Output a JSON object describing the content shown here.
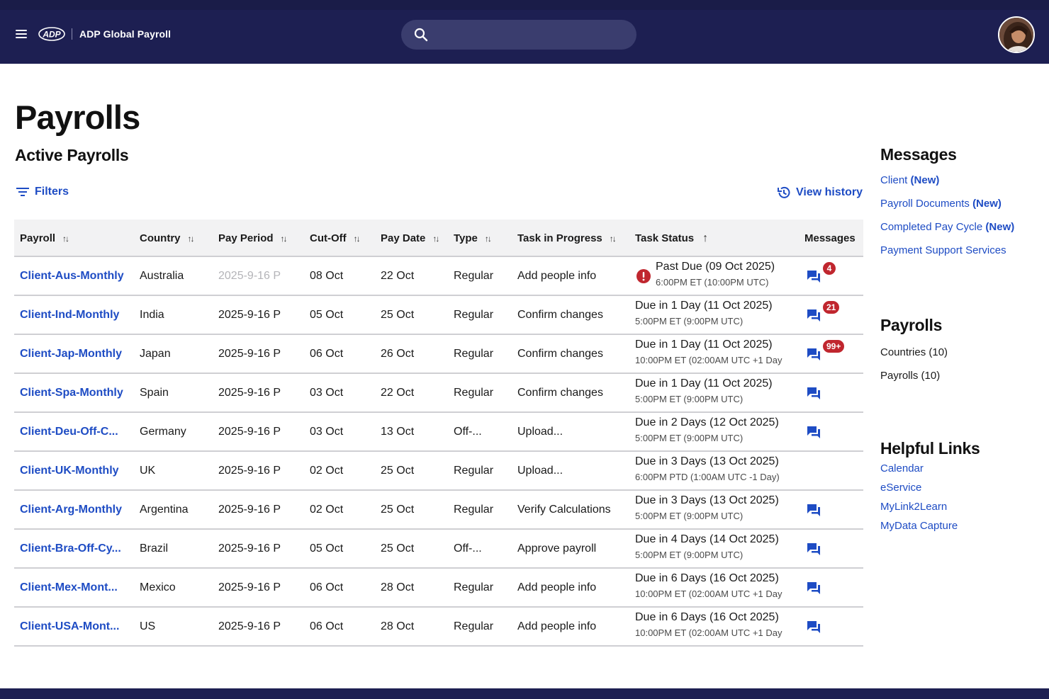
{
  "header": {
    "app_title": "ADP Global Payroll",
    "logo_text": "ADP",
    "search": {
      "value": "",
      "placeholder": ""
    }
  },
  "page": {
    "title": "Payrolls",
    "section_title": "Active Payrolls",
    "filters_label": "Filters",
    "view_history_label": "View history"
  },
  "table": {
    "columns": [
      "Payroll",
      "Country",
      "Pay Period",
      "Cut-Off",
      "Pay Date",
      "Type",
      "Task in Progress",
      "Task Status",
      "Messages"
    ],
    "rows": [
      {
        "payroll": "Client-Aus-Monthly",
        "country": "Australia",
        "pay_period": "2025-9-16 P",
        "cutoff": "08 Oct",
        "pay_date": "22 Oct",
        "type": "Regular",
        "task": "Add people info",
        "status": "Past Due (09 Oct 2025)",
        "status_time": "6:00PM ET (10:00PM UTC)",
        "alert": true,
        "messages": "4",
        "has_msg": true
      },
      {
        "payroll": "Client-Ind-Monthly",
        "country": "India",
        "pay_period": "2025-9-16 P",
        "cutoff": "05 Oct",
        "pay_date": "25 Oct",
        "type": "Regular",
        "task": "Confirm changes",
        "status": "Due in 1 Day (11 Oct 2025)",
        "status_time": "5:00PM ET (9:00PM UTC)",
        "alert": false,
        "messages": "21",
        "has_msg": true
      },
      {
        "payroll": "Client-Jap-Monthly",
        "country": "Japan",
        "pay_period": "2025-9-16 P",
        "cutoff": "06 Oct",
        "pay_date": "26 Oct",
        "type": "Regular",
        "task": "Confirm changes",
        "status": "Due in 1 Day (11 Oct 2025)",
        "status_time": "10:00PM ET (02:00AM UTC +1 Day",
        "alert": false,
        "messages": "99+",
        "has_msg": true
      },
      {
        "payroll": "Client-Spa-Monthly",
        "country": "Spain",
        "pay_period": "2025-9-16 P",
        "cutoff": "03 Oct",
        "pay_date": "22 Oct",
        "type": "Regular",
        "task": "Confirm changes",
        "status": "Due in 1 Day (11 Oct 2025)",
        "status_time": "5:00PM ET (9:00PM UTC)",
        "alert": false,
        "messages": "",
        "has_msg": true
      },
      {
        "payroll": "Client-Deu-Off-C...",
        "country": "Germany",
        "pay_period": "2025-9-16 P",
        "cutoff": "03 Oct",
        "pay_date": "13 Oct",
        "type": "Off-...",
        "task": "Upload...",
        "status": "Due in 2 Days (12 Oct 2025)",
        "status_time": "5:00PM ET (9:00PM UTC)",
        "alert": false,
        "messages": "",
        "has_msg": true
      },
      {
        "payroll": "Client-UK-Monthly",
        "country": "UK",
        "pay_period": "2025-9-16 P",
        "cutoff": "02 Oct",
        "pay_date": "25 Oct",
        "type": "Regular",
        "task": "Upload...",
        "status": "Due in 3 Days (13 Oct 2025)",
        "status_time": "6:00PM PTD (1:00AM UTC -1 Day)",
        "alert": false,
        "messages": "",
        "has_msg": false
      },
      {
        "payroll": "Client-Arg-Monthly",
        "country": "Argentina",
        "pay_period": "2025-9-16 P",
        "cutoff": "02 Oct",
        "pay_date": "25 Oct",
        "type": "Regular",
        "task": "Verify Calculations",
        "status": "Due in 3 Days (13 Oct 2025)",
        "status_time": "5:00PM ET (9:00PM UTC)",
        "alert": false,
        "messages": "",
        "has_msg": true
      },
      {
        "payroll": "Client-Bra-Off-Cy...",
        "country": "Brazil",
        "pay_period": "2025-9-16 P",
        "cutoff": "05 Oct",
        "pay_date": "25 Oct",
        "type": "Off-...",
        "task": "Approve payroll",
        "status": "Due in 4 Days (14 Oct 2025)",
        "status_time": "5:00PM ET (9:00PM UTC)",
        "alert": false,
        "messages": "",
        "has_msg": true
      },
      {
        "payroll": "Client-Mex-Mont...",
        "country": "Mexico",
        "pay_period": "2025-9-16 P",
        "cutoff": "06 Oct",
        "pay_date": "28 Oct",
        "type": "Regular",
        "task": "Add people info",
        "status": "Due in 6 Days (16 Oct 2025)",
        "status_time": "10:00PM ET (02:00AM UTC +1 Day",
        "alert": false,
        "messages": "",
        "has_msg": true
      },
      {
        "payroll": "Client-USA-Mont...",
        "country": "US",
        "pay_period": "2025-9-16 P",
        "cutoff": "06 Oct",
        "pay_date": "28 Oct",
        "type": "Regular",
        "task": "Add people info",
        "status": "Due in 6 Days (16 Oct 2025)",
        "status_time": "10:00PM ET (02:00AM UTC +1 Day",
        "alert": false,
        "messages": "",
        "has_msg": true
      }
    ]
  },
  "sidebar": {
    "messages": {
      "title": "Messages",
      "items": [
        {
          "label": "Client",
          "tag": "(New)"
        },
        {
          "label": "Payroll Documents",
          "tag": "(New)"
        },
        {
          "label": "Completed Pay Cycle",
          "tag": "(New)"
        },
        {
          "label": "Payment Support Services",
          "tag": ""
        }
      ]
    },
    "payrolls": {
      "title": "Payrolls",
      "items": [
        "Countries (10)",
        "Payrolls (10)"
      ]
    },
    "helpful_links": {
      "title": "Helpful Links",
      "items": [
        "Calendar",
        "eService",
        "MyLink2Learn",
        "MyData Capture"
      ]
    }
  },
  "colors": {
    "header_bg": "#1d1f52",
    "link": "#1e4cc4",
    "badge": "#c0262e",
    "alert": "#c0262e"
  }
}
